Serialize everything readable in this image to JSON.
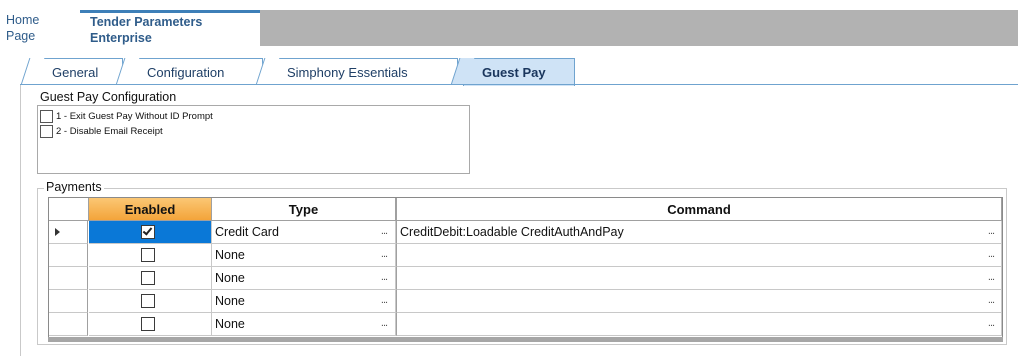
{
  "header": {
    "home_line1": "Home",
    "home_line2": "Page",
    "doc_line1": "Tender Parameters",
    "doc_line2": "Enterprise"
  },
  "tabs": [
    {
      "label": "General",
      "active": false
    },
    {
      "label": "Configuration",
      "active": false
    },
    {
      "label": "Simphony Essentials",
      "active": false
    },
    {
      "label": "Guest Pay",
      "active": true
    }
  ],
  "guest_pay_config": {
    "title": "Guest Pay Configuration",
    "options": [
      {
        "label": "1 - Exit Guest Pay Without ID Prompt",
        "checked": false
      },
      {
        "label": "2 - Disable Email Receipt",
        "checked": false
      }
    ]
  },
  "payments": {
    "title": "Payments",
    "columns": {
      "enabled": "Enabled",
      "type": "Type",
      "command": "Command"
    },
    "ellipsis": "...",
    "rows": [
      {
        "enabled": true,
        "type": "Credit Card",
        "command": "CreditDebit:Loadable CreditAuthAndPay",
        "selected": true
      },
      {
        "enabled": false,
        "type": "None",
        "command": "",
        "selected": false
      },
      {
        "enabled": false,
        "type": "None",
        "command": "",
        "selected": false
      },
      {
        "enabled": false,
        "type": "None",
        "command": "",
        "selected": false
      },
      {
        "enabled": false,
        "type": "None",
        "command": "",
        "selected": false
      }
    ]
  },
  "colors": {
    "accent_blue": "#3d7fb8",
    "active_tab": "#cfe3f6",
    "header_gray": "#b2b2b2",
    "enabled_header_orange": "#f3a43a",
    "selection_blue": "#0a78d7"
  }
}
